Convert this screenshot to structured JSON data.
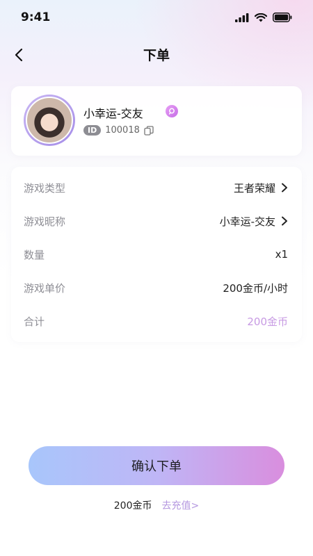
{
  "status_bar": {
    "time": "9:41"
  },
  "nav": {
    "title": "下单"
  },
  "profile": {
    "name": "小幸运-交友",
    "id_tag": "ID",
    "id_value": "100018"
  },
  "order": {
    "rows": [
      {
        "label": "游戏类型",
        "value": "王者荣耀",
        "has_arrow": true
      },
      {
        "label": "游戏昵称",
        "value": "小幸运-交友",
        "has_arrow": true
      },
      {
        "label": "数量",
        "value": "x1",
        "has_arrow": false
      },
      {
        "label": "游戏单价",
        "value": "200金币/小时",
        "has_arrow": false
      },
      {
        "label": "合计",
        "value": "200金币",
        "has_arrow": false
      }
    ]
  },
  "confirm": {
    "label": "确认下单"
  },
  "balance": {
    "amount": "200金币",
    "recharge_label": "去充值>"
  },
  "icons": {
    "back": "chevron-left-icon",
    "verify": "verified-badge-icon",
    "copy": "copy-icon",
    "arrow": "chevron-right-icon",
    "signal": "cellular-signal-icon",
    "wifi": "wifi-icon",
    "battery": "battery-icon"
  },
  "colors": {
    "accent_total": "#c79ae3",
    "recharge_link": "#b497e0",
    "button_gradient": [
      "#a8c6fb",
      "#bfb6f6",
      "#d98ede"
    ]
  }
}
